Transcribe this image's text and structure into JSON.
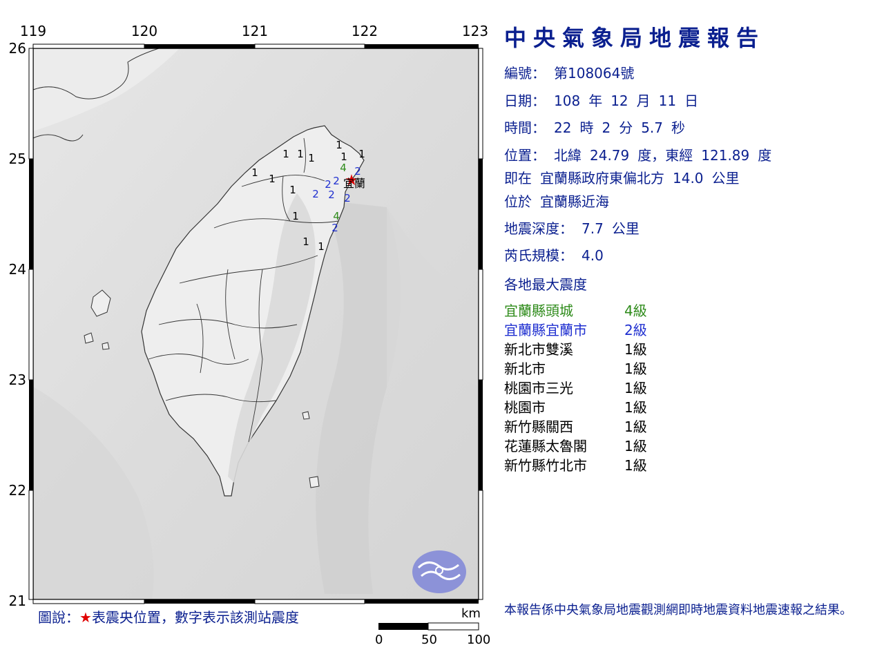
{
  "report": {
    "title": "中央氣象局地震報告",
    "number_label": "編號：",
    "number": "第108064號",
    "date_label": "日期：",
    "date_year": "108",
    "date_year_unit": "年",
    "date_month": "12",
    "date_month_unit": "月",
    "date_day": "11",
    "date_day_unit": "日",
    "time_label": "時間：",
    "time_hour": "22",
    "time_hour_unit": "時",
    "time_min": "2",
    "time_min_unit": "分",
    "time_sec": "5.7",
    "time_sec_unit": "秒",
    "position_label": "位置：",
    "lat_label": "北緯",
    "lat": "24.79",
    "lat_unit": "度，",
    "lon_label": "東經",
    "lon": "121.89",
    "lon_unit": "度",
    "relative_prefix": "即在",
    "relative_ref": "宜蘭縣政府東偏北方",
    "relative_dist": "14.0",
    "relative_unit": "公里",
    "region_prefix": "位於",
    "region": "宜蘭縣近海",
    "depth_label": "地震深度：",
    "depth": "7.7",
    "depth_unit": "公里",
    "magnitude_label": "芮氏規模：",
    "magnitude": "4.0",
    "intensity_header": "各地最大震度",
    "intensities": [
      {
        "location": "宜蘭縣頭城",
        "level": "4級",
        "color": "#2e8b1a"
      },
      {
        "location": "宜蘭縣宜蘭市",
        "level": "2級",
        "color": "#1f2fd0"
      },
      {
        "location": "新北市雙溪",
        "level": "1級",
        "color": "#000000"
      },
      {
        "location": "新北市",
        "level": "1級",
        "color": "#000000"
      },
      {
        "location": "桃園市三光",
        "level": "1級",
        "color": "#000000"
      },
      {
        "location": "桃園市",
        "level": "1級",
        "color": "#000000"
      },
      {
        "location": "新竹縣關西",
        "level": "1級",
        "color": "#000000"
      },
      {
        "location": "花蓮縣太魯閣",
        "level": "1級",
        "color": "#000000"
      },
      {
        "location": "新竹縣竹北市",
        "level": "1級",
        "color": "#000000"
      }
    ],
    "footer": "本報告係中央氣象局地震觀測網即時地震資料地震速報之結果。"
  },
  "map": {
    "lon_ticks": [
      "119",
      "120",
      "121",
      "122",
      "123"
    ],
    "lat_ticks": [
      "26",
      "25",
      "24",
      "23",
      "22",
      "21"
    ],
    "epicenter_label": "宜蘭",
    "epicenter_icon": "star-icon",
    "epicenter_color": "#e00000",
    "stations": [
      {
        "value": "4",
        "color": "#2e8b1a"
      },
      {
        "value": "2",
        "color": "#1f2fd0"
      },
      {
        "value": "2",
        "color": "#1f2fd0"
      },
      {
        "value": "2",
        "color": "#1f2fd0"
      },
      {
        "value": "2",
        "color": "#1f2fd0"
      },
      {
        "value": "2",
        "color": "#1f2fd0"
      },
      {
        "value": "2",
        "color": "#1f2fd0"
      },
      {
        "value": "4",
        "color": "#2e8b1a"
      },
      {
        "value": "2",
        "color": "#1f2fd0"
      },
      {
        "value": "1",
        "color": "#000000"
      },
      {
        "value": "1",
        "color": "#000000"
      },
      {
        "value": "1",
        "color": "#000000"
      },
      {
        "value": "1",
        "color": "#000000"
      },
      {
        "value": "1",
        "color": "#000000"
      },
      {
        "value": "1",
        "color": "#000000"
      },
      {
        "value": "1",
        "color": "#000000"
      },
      {
        "value": "1",
        "color": "#000000"
      },
      {
        "value": "1",
        "color": "#000000"
      },
      {
        "value": "1",
        "color": "#000000"
      },
      {
        "value": "1",
        "color": "#000000"
      },
      {
        "value": "1",
        "color": "#000000"
      }
    ],
    "legend_prefix": "圖說：",
    "legend_star": "★",
    "legend_text": "表震央位置，數字表示該測站震度",
    "scale_unit": "km",
    "scale_labels": [
      "0",
      "50",
      "100"
    ],
    "logo_icon": "cwb-logo-icon"
  }
}
